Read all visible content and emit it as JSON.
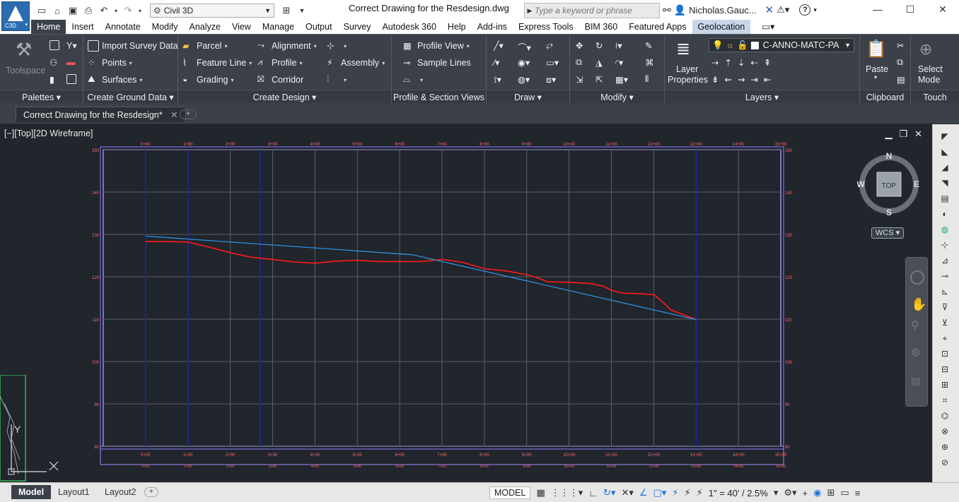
{
  "app": {
    "logo_label": "C3D",
    "document_title": "Correct Drawing for the Resdesign.dwg",
    "workspace": "Civil 3D",
    "search_placeholder": "Type a keyword or phrase",
    "user_name": "Nicholas.Gauc...",
    "help": "?"
  },
  "ribbon_tabs": [
    "Home",
    "Insert",
    "Annotate",
    "Modify",
    "Analyze",
    "View",
    "Manage",
    "Output",
    "Survey",
    "Autodesk 360",
    "Help",
    "Add-ins",
    "Express Tools",
    "BIM 360",
    "Featured Apps",
    "Geolocation"
  ],
  "panels": {
    "palettes": "Palettes",
    "ground": "Create Ground Data",
    "design": "Create Design",
    "profile_section": "Profile & Section Views",
    "draw": "Draw",
    "modify": "Modify",
    "layers": "Layers",
    "clipboard": "Clipboard",
    "touch": "Touch"
  },
  "ribbon_items": {
    "toolspace": "Toolspace",
    "import_survey": "Import Survey Data",
    "points": "Points",
    "surfaces": "Surfaces",
    "parcel": "Parcel",
    "feature_line": "Feature Line",
    "grading": "Grading",
    "alignment": "Alignment",
    "profile": "Profile",
    "corridor": "Corridor",
    "assembly": "Assembly",
    "profile_view": "Profile View",
    "sample_lines": "Sample Lines",
    "layer_properties_1": "Layer",
    "layer_properties_2": "Properties",
    "layer_name": "C-ANNO-MATC-PA",
    "paste": "Paste",
    "select_mode_1": "Select",
    "select_mode_2": "Mode"
  },
  "document_tab": "Correct Drawing for the Resdesign*",
  "viewport": {
    "label": "[−][Top][2D Wireframe]",
    "wcs": "WCS",
    "compass": {
      "n": "N",
      "s": "S",
      "e": "E",
      "w": "W",
      "top": "TOP"
    },
    "ucs_y": "Y"
  },
  "chart_data": {
    "type": "line",
    "title": "",
    "xlabel": "",
    "ylabel": "",
    "x_ticks": [
      "0+00",
      "1+00",
      "2+00",
      "3+00",
      "4+00",
      "5+00",
      "6+00",
      "7+00",
      "8+00",
      "9+00",
      "10+00",
      "11+00",
      "12+00",
      "13+00",
      "14+00",
      "15+00"
    ],
    "y_ticks": [
      80,
      90,
      100,
      110,
      120,
      130,
      140,
      150
    ],
    "xlim": [
      -1,
      15
    ],
    "ylim": [
      80,
      150
    ],
    "series": [
      {
        "color": "#ff1a1a",
        "x": [
          0,
          0.5,
          1,
          1.5,
          2,
          2.5,
          3,
          3.5,
          4,
          4.5,
          5,
          5.5,
          6,
          6.5,
          7,
          7.5,
          8,
          8.5,
          9,
          9.3,
          9.5,
          10,
          10.5,
          10.8,
          11,
          11.3,
          11.5,
          12,
          12.2,
          12.4,
          13
        ],
        "values": [
          128.3,
          128.3,
          128.2,
          127,
          125.7,
          124.6,
          124.1,
          123.5,
          123.2,
          123.7,
          123.9,
          123.6,
          123.6,
          123.6,
          124.1,
          123.4,
          121.9,
          121.4,
          120.5,
          119.6,
          118.8,
          118.7,
          118.4,
          117.8,
          116.8,
          116.1,
          116.1,
          115.8,
          114.2,
          112.2,
          109.9
        ]
      },
      {
        "color": "#2f8fe0",
        "x": [
          0,
          6.3,
          13
        ],
        "values": [
          129.6,
          125.2,
          109.9
        ]
      }
    ],
    "vertical_markers": [
      0,
      1,
      2.7,
      13
    ],
    "grid": true
  },
  "status": {
    "layouts": [
      "Model",
      "Layout1",
      "Layout2"
    ],
    "model": "MODEL",
    "scale": "1\" = 40' / 2.5%"
  }
}
